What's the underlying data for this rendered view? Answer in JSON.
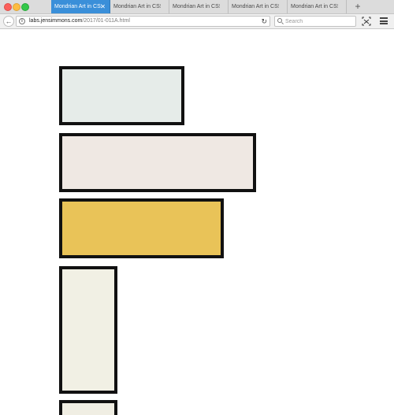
{
  "tabs": [
    {
      "label": "Mondrian Art in CSS",
      "active": true
    },
    {
      "label": "Mondrian Art in CSS Gr",
      "active": false
    },
    {
      "label": "Mondrian Art in CSS Gr",
      "active": false
    },
    {
      "label": "Mondrian Art in CSS Gr",
      "active": false
    },
    {
      "label": "Mondrian Art in CSS Gr",
      "active": false
    }
  ],
  "tab_close": "✕",
  "new_tab": "+",
  "nav": {
    "back": "←",
    "url_host": "labs.jensimmons.com",
    "url_path": "/2017/01-011A.html",
    "reload": "↻",
    "search_placeholder": "Search"
  },
  "colors": {
    "active_tab": "#3a8fd9",
    "border": "#111111",
    "yellow": "#e9c358",
    "pale_1": "#e6ece9",
    "pale_2": "#efe8e3",
    "pale_3": "#f1f0e4"
  },
  "icons": [
    "info-icon",
    "reload-icon",
    "search-icon",
    "screenshot-icon",
    "hamburger-menu-icon",
    "back-arrow-icon",
    "close-icon",
    "plus-icon"
  ]
}
